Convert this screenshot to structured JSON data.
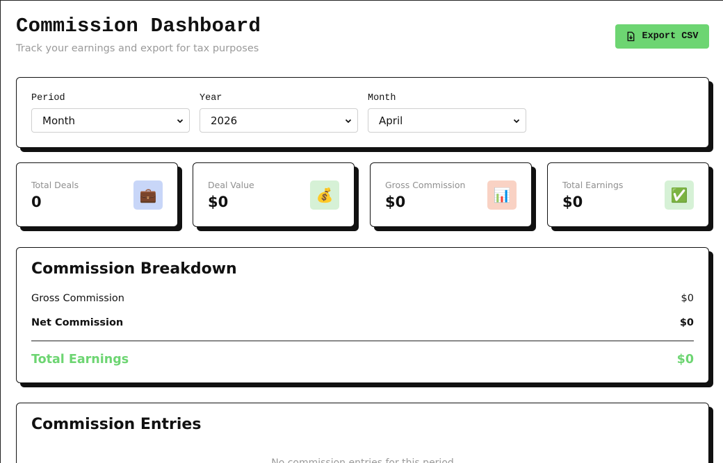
{
  "header": {
    "title": "Commission Dashboard",
    "subtitle": "Track your earnings and export for tax purposes",
    "export_label": "Export CSV"
  },
  "filters": {
    "period": {
      "label": "Period",
      "value": "Month"
    },
    "year": {
      "label": "Year",
      "value": "2026"
    },
    "month": {
      "label": "Month",
      "value": "April"
    }
  },
  "stats": [
    {
      "label": "Total Deals",
      "value": "0",
      "icon": "briefcase-icon",
      "glyph": "💼",
      "bg": "#c8d6f8"
    },
    {
      "label": "Deal Value",
      "value": "$0",
      "icon": "money-bag-icon",
      "glyph": "💰",
      "bg": "#d6f1d6"
    },
    {
      "label": "Gross Commission",
      "value": "$0",
      "icon": "bar-chart-icon",
      "glyph": "📊",
      "bg": "#f9d2c4"
    },
    {
      "label": "Total Earnings",
      "value": "$0",
      "icon": "check-mark-icon",
      "glyph": "✅",
      "bg": "#d6f1d6"
    }
  ],
  "breakdown": {
    "title": "Commission Breakdown",
    "gross_label": "Gross Commission",
    "gross_value": "$0",
    "net_label": "Net Commission",
    "net_value": "$0",
    "total_label": "Total Earnings",
    "total_value": "$0"
  },
  "entries": {
    "title": "Commission Entries",
    "empty_text": "No commission entries for this period"
  },
  "colors": {
    "accent": "#6dd572",
    "muted": "#9a9a9a",
    "border": "#111111"
  }
}
